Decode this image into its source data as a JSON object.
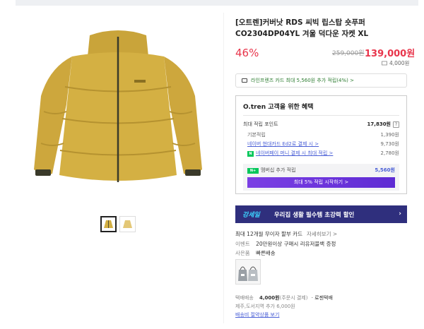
{
  "product": {
    "title": "[오트렌]커버낫 RDS 씨빅 립스탑 숏푸퍼 CO2304DP04YL 겨울 덕다운 자켓 XL",
    "discount": "46%",
    "original_price": "259,000원",
    "sale_price": "139,000원",
    "point_stamp": "4,000원"
  },
  "card_banner": {
    "text": "라인프렌즈 카드 최대 5,560원 추가 적립(4%) >"
  },
  "benefits": {
    "title": "O.tren 고객을 위한 혜택",
    "max_points_label": "최대 적립 포인트",
    "max_points_value": "17,830원",
    "help": "?",
    "rows": [
      {
        "label": "기본적립",
        "value": "1,390원",
        "link": false
      },
      {
        "label": "네이버 현대카드 Ed2로 결제 시 >",
        "value": "9,730원",
        "link": true
      },
      {
        "label": "네이버페이 머니 결제 시 최대 적립 >",
        "value": "2,780원",
        "link": true,
        "badge": "N"
      }
    ],
    "member": {
      "badge": "N+",
      "label": "멤버십 추가 적립",
      "value": "5,560원",
      "cta": "최대 5% 적립 시작하기 >"
    }
  },
  "promo": {
    "logo": "강세일",
    "text": "우리집 생활 필수템 초강력 할인",
    "arrow": "›"
  },
  "info": {
    "installment": "최대 12개월 무이자 할부 카드",
    "installment_link": "자세히보기 >",
    "event_label": "이벤트",
    "event_text": "20만원이상 구매시 리유저블백 증정",
    "gift_label": "사은품",
    "gift_text": "빠른배송"
  },
  "shipping": {
    "label": "택배배송",
    "fee": "4,000원",
    "fee_note": "(주문시 결제)",
    "carrier": "· 로젠택배",
    "jeju": "제주,도서지역 추가 6,000원",
    "link": "배송비 절약상품 보기"
  },
  "colors": {
    "price_red": "#e8354b",
    "link_blue": "#4a5fd6",
    "jacket_yellow": "#d4b043",
    "promo_navy": "#2f2f7d"
  }
}
